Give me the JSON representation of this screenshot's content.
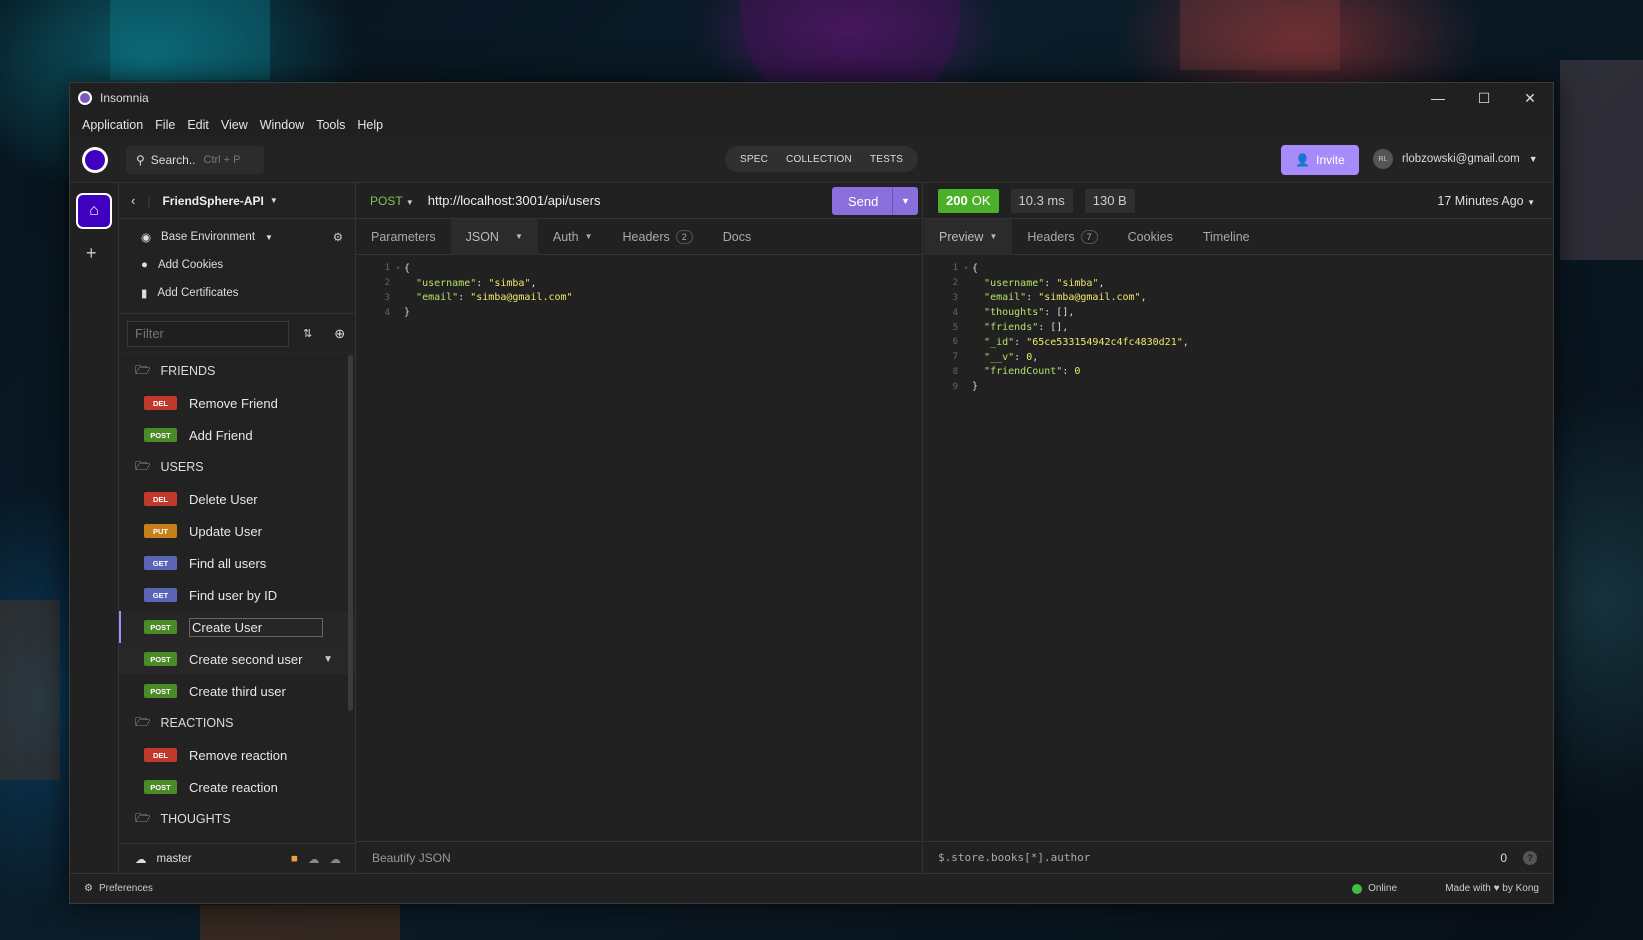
{
  "window": {
    "title": "Insomnia"
  },
  "menu": [
    "Application",
    "File",
    "Edit",
    "View",
    "Window",
    "Tools",
    "Help"
  ],
  "topbar": {
    "search_label": "Search..",
    "search_shortcut": "Ctrl + P",
    "modes": [
      "SPEC",
      "COLLECTION",
      "TESTS"
    ],
    "invite_label": "Invite",
    "user_email": "rlobzowski@gmail.com",
    "user_initials": "RL"
  },
  "sidebar": {
    "project": "FriendSphere-API",
    "options": [
      "Base Environment",
      "Add Cookies",
      "Add Certificates"
    ],
    "filter_placeholder": "Filter",
    "tree": [
      {
        "kind": "folder",
        "label": "FRIENDS"
      },
      {
        "kind": "request",
        "method": "DEL",
        "label": "Remove Friend"
      },
      {
        "kind": "request",
        "method": "POST",
        "label": "Add Friend"
      },
      {
        "kind": "folder",
        "label": "USERS"
      },
      {
        "kind": "request",
        "method": "DEL",
        "label": "Delete User"
      },
      {
        "kind": "request",
        "method": "PUT",
        "label": "Update User"
      },
      {
        "kind": "request",
        "method": "GET",
        "label": "Find all users"
      },
      {
        "kind": "request",
        "method": "GET",
        "label": "Find user by ID"
      },
      {
        "kind": "request",
        "method": "POST",
        "label": "Create User",
        "state": "active-editing"
      },
      {
        "kind": "request",
        "method": "POST",
        "label": "Create second user",
        "state": "hover"
      },
      {
        "kind": "request",
        "method": "POST",
        "label": "Create third user"
      },
      {
        "kind": "folder",
        "label": "REACTIONS"
      },
      {
        "kind": "request",
        "method": "DEL",
        "label": "Remove reaction"
      },
      {
        "kind": "request",
        "method": "POST",
        "label": "Create reaction"
      },
      {
        "kind": "folder",
        "label": "THOUGHTS"
      }
    ],
    "branch": "master"
  },
  "request": {
    "method": "POST",
    "url": "http://localhost:3001/api/users",
    "send_label": "Send",
    "tabs": {
      "params": "Parameters",
      "body": "JSON",
      "auth": "Auth",
      "headers": "Headers",
      "headers_count": "2",
      "docs": "Docs"
    },
    "body_lines": [
      {
        "n": "1",
        "fold": true,
        "html": "{"
      },
      {
        "n": "2",
        "html": "  <span class=\"k\">\"username\"</span>: <span class=\"s\">\"simba\"</span>,"
      },
      {
        "n": "3",
        "html": "  <span class=\"k\">\"email\"</span>: <span class=\"s\">\"simba@gmail.com\"</span>"
      },
      {
        "n": "4",
        "html": "}"
      }
    ],
    "footer_label": "Beautify JSON"
  },
  "response": {
    "status_code": "200",
    "status_text": "OK",
    "time": "10.3 ms",
    "size": "130 B",
    "age": "17 Minutes Ago",
    "tabs": {
      "preview": "Preview",
      "headers": "Headers",
      "headers_count": "7",
      "cookies": "Cookies",
      "timeline": "Timeline"
    },
    "body_lines": [
      {
        "n": "1",
        "fold": true,
        "html": "{"
      },
      {
        "n": "2",
        "html": "  <span class=\"k\">\"username\"</span>: <span class=\"s\">\"simba\"</span>,"
      },
      {
        "n": "3",
        "html": "  <span class=\"k\">\"email\"</span>: <span class=\"s\">\"simba@gmail.com\"</span>,"
      },
      {
        "n": "4",
        "html": "  <span class=\"k\">\"thoughts\"</span>: [],"
      },
      {
        "n": "5",
        "html": "  <span class=\"k\">\"friends\"</span>: [],"
      },
      {
        "n": "6",
        "html": "  <span class=\"k\">\"_id\"</span>: <span class=\"s\">\"65ce533154942c4fc4830d21\"</span>,"
      },
      {
        "n": "7",
        "html": "  <span class=\"k\">\"__v\"</span>: <span class=\"n\">0</span>,"
      },
      {
        "n": "8",
        "html": "  <span class=\"k\">\"friendCount\"</span>: <span class=\"n\">0</span>"
      },
      {
        "n": "9",
        "html": "}"
      }
    ],
    "filter_text": "$.store.books[*].author",
    "filter_count": "0"
  },
  "statusbar": {
    "preferences": "Preferences",
    "online": "Online",
    "made_with": "Made with",
    "by": "by Kong"
  },
  "colors": {
    "accent": "#a78bfa",
    "ok": "#4caf2a",
    "del": "#c0392b",
    "post": "#4a8a2a",
    "put": "#c77f1a",
    "get": "#5a66b5"
  }
}
